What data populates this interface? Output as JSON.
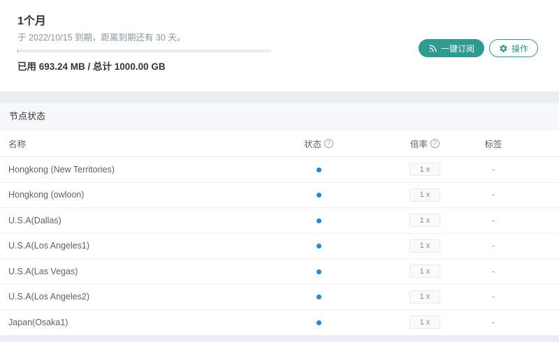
{
  "colors": {
    "accent": "#2f9a8f",
    "status_online": "#1e88e5"
  },
  "plan": {
    "name": "1个月",
    "expiry_text": "于 2022/10/15 到期，距离到期还有 30 天。",
    "usage_text": "已用 693.24 MB / 总计 1000.00 GB",
    "progress_percent": 0.07,
    "subscribe_label": "一键订阅",
    "actions_label": "操作"
  },
  "nodes": {
    "section_title": "节点状态",
    "columns": {
      "name": "名称",
      "status": "状态",
      "rate": "倍率",
      "tag": "标签"
    },
    "help_glyph": "?",
    "rows": [
      {
        "name": "Hongkong (New Territories)",
        "status": "online",
        "rate": "1 x",
        "tag": "-"
      },
      {
        "name": "Hongkong (owloon)",
        "status": "online",
        "rate": "1 x",
        "tag": "-"
      },
      {
        "name": "U.S.A(Dallas)",
        "status": "online",
        "rate": "1 x",
        "tag": "-"
      },
      {
        "name": "U.S.A(Los Angeles1)",
        "status": "online",
        "rate": "1 x",
        "tag": "-"
      },
      {
        "name": "U.S.A(Las Vegas)",
        "status": "online",
        "rate": "1 x",
        "tag": "-"
      },
      {
        "name": "U.S.A(Los Angeles2)",
        "status": "online",
        "rate": "1 x",
        "tag": "-"
      },
      {
        "name": "Japan(Osaka1)",
        "status": "online",
        "rate": "1 x",
        "tag": "-"
      }
    ]
  }
}
